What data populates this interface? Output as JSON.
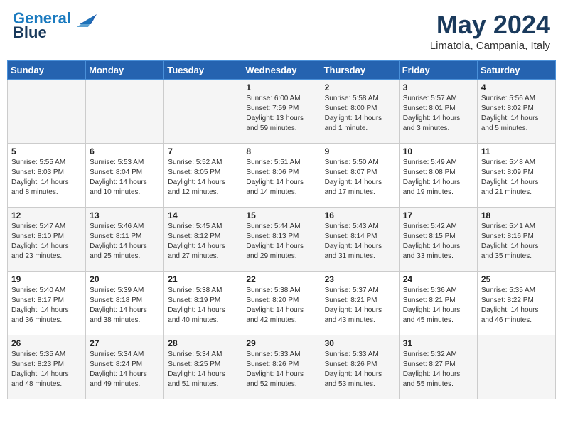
{
  "header": {
    "logo_line1": "General",
    "logo_line2": "Blue",
    "month": "May 2024",
    "location": "Limatola, Campania, Italy"
  },
  "weekdays": [
    "Sunday",
    "Monday",
    "Tuesday",
    "Wednesday",
    "Thursday",
    "Friday",
    "Saturday"
  ],
  "weeks": [
    [
      {
        "day": "",
        "content": ""
      },
      {
        "day": "",
        "content": ""
      },
      {
        "day": "",
        "content": ""
      },
      {
        "day": "1",
        "content": "Sunrise: 6:00 AM\nSunset: 7:59 PM\nDaylight: 13 hours\nand 59 minutes."
      },
      {
        "day": "2",
        "content": "Sunrise: 5:58 AM\nSunset: 8:00 PM\nDaylight: 14 hours\nand 1 minute."
      },
      {
        "day": "3",
        "content": "Sunrise: 5:57 AM\nSunset: 8:01 PM\nDaylight: 14 hours\nand 3 minutes."
      },
      {
        "day": "4",
        "content": "Sunrise: 5:56 AM\nSunset: 8:02 PM\nDaylight: 14 hours\nand 5 minutes."
      }
    ],
    [
      {
        "day": "5",
        "content": "Sunrise: 5:55 AM\nSunset: 8:03 PM\nDaylight: 14 hours\nand 8 minutes."
      },
      {
        "day": "6",
        "content": "Sunrise: 5:53 AM\nSunset: 8:04 PM\nDaylight: 14 hours\nand 10 minutes."
      },
      {
        "day": "7",
        "content": "Sunrise: 5:52 AM\nSunset: 8:05 PM\nDaylight: 14 hours\nand 12 minutes."
      },
      {
        "day": "8",
        "content": "Sunrise: 5:51 AM\nSunset: 8:06 PM\nDaylight: 14 hours\nand 14 minutes."
      },
      {
        "day": "9",
        "content": "Sunrise: 5:50 AM\nSunset: 8:07 PM\nDaylight: 14 hours\nand 17 minutes."
      },
      {
        "day": "10",
        "content": "Sunrise: 5:49 AM\nSunset: 8:08 PM\nDaylight: 14 hours\nand 19 minutes."
      },
      {
        "day": "11",
        "content": "Sunrise: 5:48 AM\nSunset: 8:09 PM\nDaylight: 14 hours\nand 21 minutes."
      }
    ],
    [
      {
        "day": "12",
        "content": "Sunrise: 5:47 AM\nSunset: 8:10 PM\nDaylight: 14 hours\nand 23 minutes."
      },
      {
        "day": "13",
        "content": "Sunrise: 5:46 AM\nSunset: 8:11 PM\nDaylight: 14 hours\nand 25 minutes."
      },
      {
        "day": "14",
        "content": "Sunrise: 5:45 AM\nSunset: 8:12 PM\nDaylight: 14 hours\nand 27 minutes."
      },
      {
        "day": "15",
        "content": "Sunrise: 5:44 AM\nSunset: 8:13 PM\nDaylight: 14 hours\nand 29 minutes."
      },
      {
        "day": "16",
        "content": "Sunrise: 5:43 AM\nSunset: 8:14 PM\nDaylight: 14 hours\nand 31 minutes."
      },
      {
        "day": "17",
        "content": "Sunrise: 5:42 AM\nSunset: 8:15 PM\nDaylight: 14 hours\nand 33 minutes."
      },
      {
        "day": "18",
        "content": "Sunrise: 5:41 AM\nSunset: 8:16 PM\nDaylight: 14 hours\nand 35 minutes."
      }
    ],
    [
      {
        "day": "19",
        "content": "Sunrise: 5:40 AM\nSunset: 8:17 PM\nDaylight: 14 hours\nand 36 minutes."
      },
      {
        "day": "20",
        "content": "Sunrise: 5:39 AM\nSunset: 8:18 PM\nDaylight: 14 hours\nand 38 minutes."
      },
      {
        "day": "21",
        "content": "Sunrise: 5:38 AM\nSunset: 8:19 PM\nDaylight: 14 hours\nand 40 minutes."
      },
      {
        "day": "22",
        "content": "Sunrise: 5:38 AM\nSunset: 8:20 PM\nDaylight: 14 hours\nand 42 minutes."
      },
      {
        "day": "23",
        "content": "Sunrise: 5:37 AM\nSunset: 8:21 PM\nDaylight: 14 hours\nand 43 minutes."
      },
      {
        "day": "24",
        "content": "Sunrise: 5:36 AM\nSunset: 8:21 PM\nDaylight: 14 hours\nand 45 minutes."
      },
      {
        "day": "25",
        "content": "Sunrise: 5:35 AM\nSunset: 8:22 PM\nDaylight: 14 hours\nand 46 minutes."
      }
    ],
    [
      {
        "day": "26",
        "content": "Sunrise: 5:35 AM\nSunset: 8:23 PM\nDaylight: 14 hours\nand 48 minutes."
      },
      {
        "day": "27",
        "content": "Sunrise: 5:34 AM\nSunset: 8:24 PM\nDaylight: 14 hours\nand 49 minutes."
      },
      {
        "day": "28",
        "content": "Sunrise: 5:34 AM\nSunset: 8:25 PM\nDaylight: 14 hours\nand 51 minutes."
      },
      {
        "day": "29",
        "content": "Sunrise: 5:33 AM\nSunset: 8:26 PM\nDaylight: 14 hours\nand 52 minutes."
      },
      {
        "day": "30",
        "content": "Sunrise: 5:33 AM\nSunset: 8:26 PM\nDaylight: 14 hours\nand 53 minutes."
      },
      {
        "day": "31",
        "content": "Sunrise: 5:32 AM\nSunset: 8:27 PM\nDaylight: 14 hours\nand 55 minutes."
      },
      {
        "day": "",
        "content": ""
      }
    ]
  ]
}
